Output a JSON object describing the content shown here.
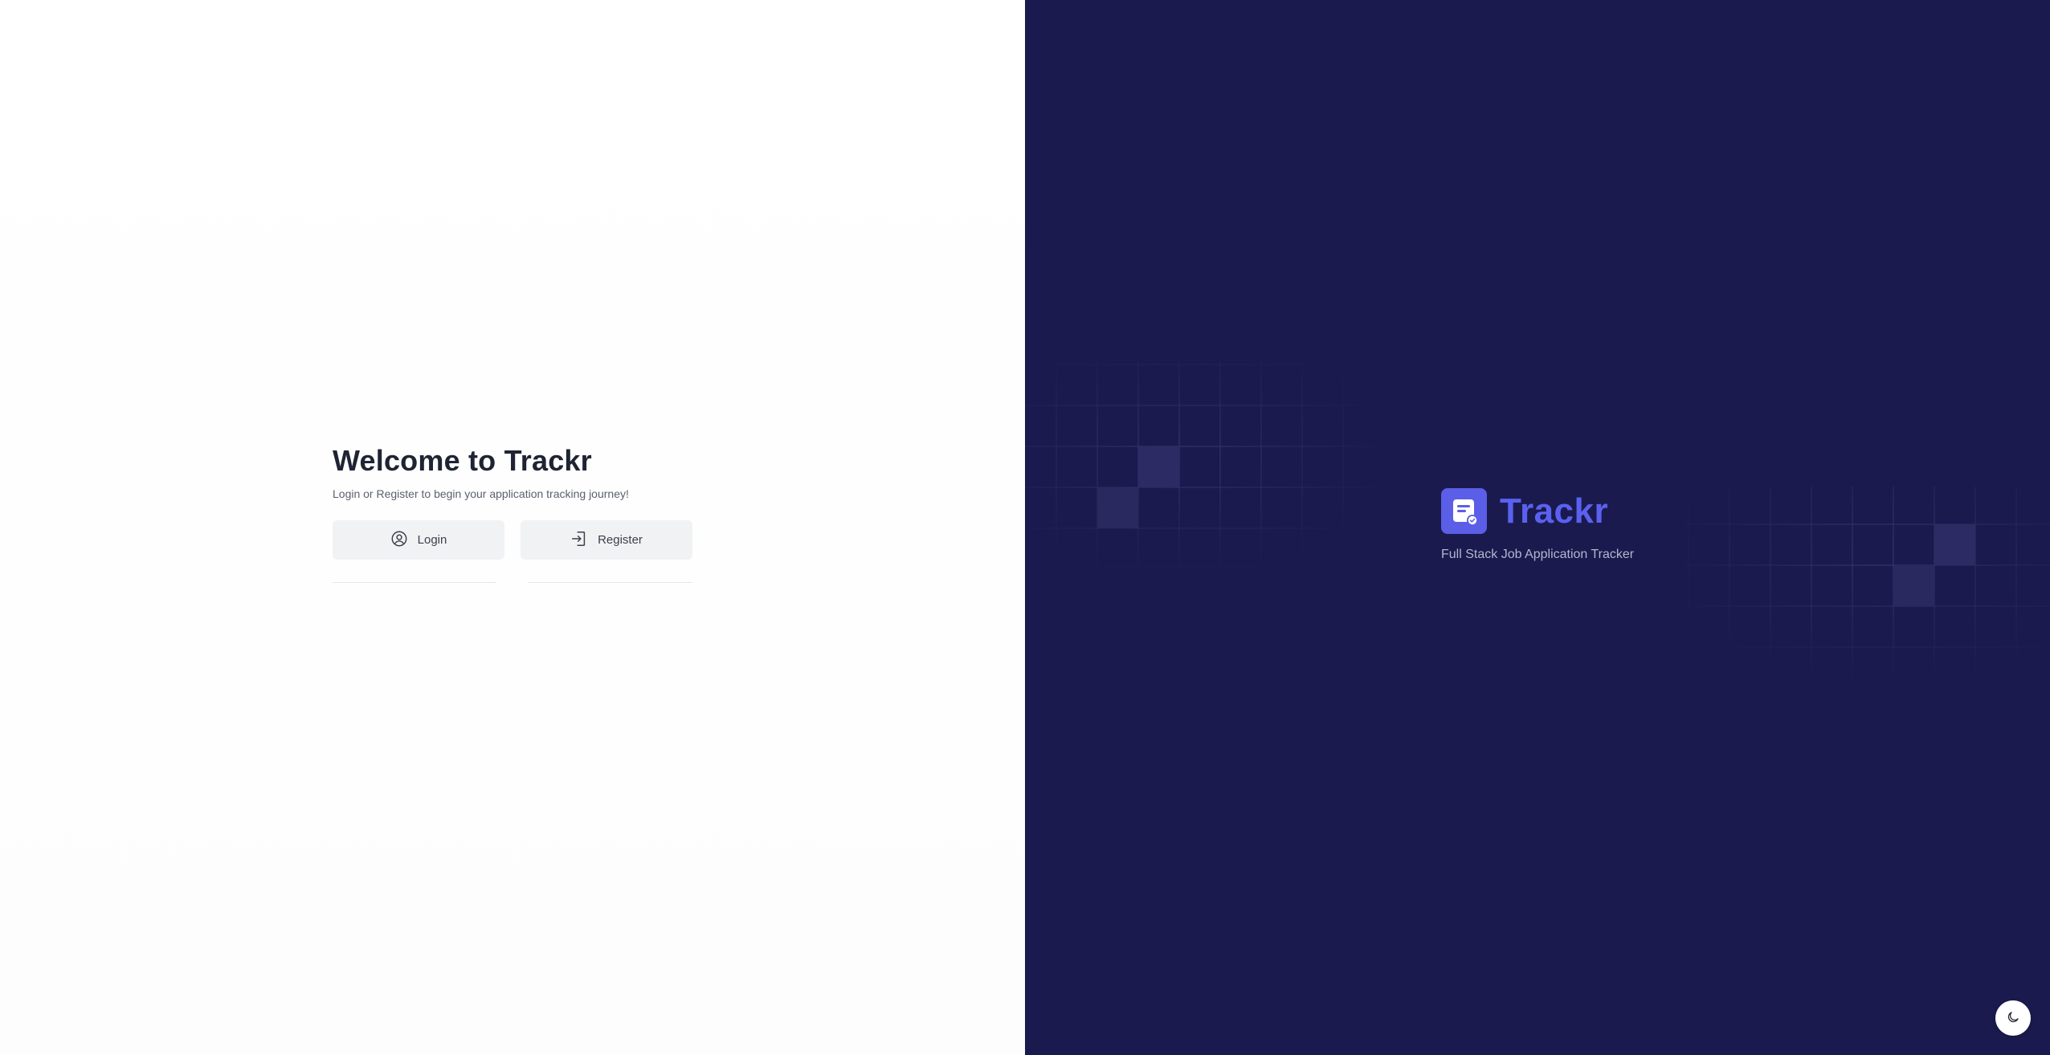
{
  "left": {
    "title": "Welcome to Trackr",
    "subtitle": "Login or Register to begin your application tracking journey!",
    "buttons": {
      "login": "Login",
      "register": "Register"
    }
  },
  "right": {
    "brand_name": "Trackr",
    "tagline": "Full Stack Job Application Tracker",
    "icons": {
      "logo": "clipboard-check-icon",
      "theme_toggle": "moon-icon"
    }
  },
  "colors": {
    "right_panel_bg": "#1b1a4e",
    "brand_accent": "#5a61f0",
    "logo_bg": "#5b5ee6",
    "button_bg": "#f1f2f4",
    "title_color": "#1e2433"
  }
}
